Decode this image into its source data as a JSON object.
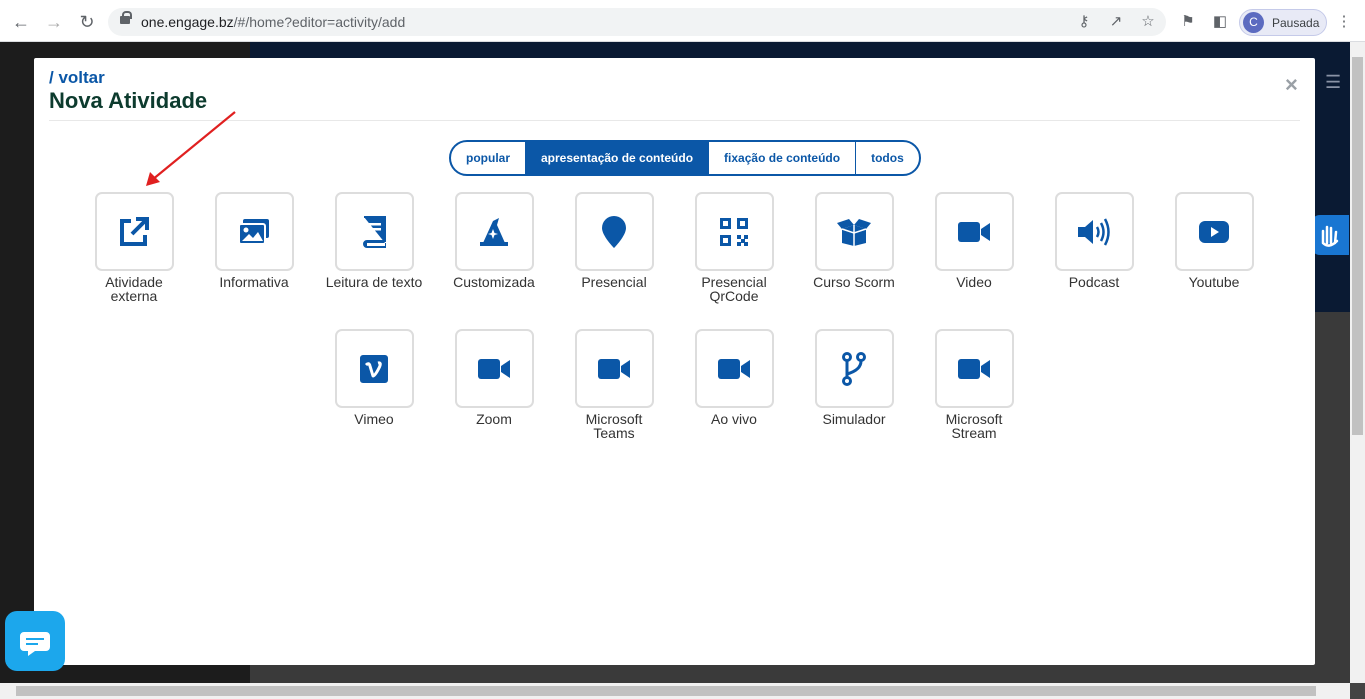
{
  "browser": {
    "url_host": "one.engage.bz",
    "url_path": "/#/home?editor=activity/add",
    "profile_initial": "C",
    "profile_label": "Pausada"
  },
  "modal": {
    "back_label": "/ voltar",
    "title": "Nova Atividade",
    "close_label": "×"
  },
  "tabs": [
    {
      "label": "popular",
      "active": false
    },
    {
      "label": "apresentação de conteúdo",
      "active": true
    },
    {
      "label": "fixação de conteúdo",
      "active": false
    },
    {
      "label": "todos",
      "active": false
    }
  ],
  "tiles": [
    {
      "line1": "Atividade",
      "line2": "externa",
      "icon": "external-link-icon"
    },
    {
      "line1": "Informativa",
      "line2": "",
      "icon": "images-icon"
    },
    {
      "line1": "Leitura de texto",
      "line2": "",
      "icon": "book-icon"
    },
    {
      "line1": "Customizada",
      "line2": "",
      "icon": "wizard-hat-icon"
    },
    {
      "line1": "Presencial",
      "line2": "",
      "icon": "map-pin-icon"
    },
    {
      "line1": "Presencial",
      "line2": "QrCode",
      "icon": "qrcode-icon"
    },
    {
      "line1": "Curso Scorm",
      "line2": "",
      "icon": "box-open-icon"
    },
    {
      "line1": "Video",
      "line2": "",
      "icon": "video-camera-icon"
    },
    {
      "line1": "Podcast",
      "line2": "",
      "icon": "volume-icon"
    },
    {
      "line1": "Youtube",
      "line2": "",
      "icon": "youtube-icon"
    },
    {
      "line1": "Vimeo",
      "line2": "",
      "icon": "vimeo-icon"
    },
    {
      "line1": "Zoom",
      "line2": "",
      "icon": "video-camera-icon"
    },
    {
      "line1": "Microsoft",
      "line2": "Teams",
      "icon": "video-camera-icon"
    },
    {
      "line1": "Ao vivo",
      "line2": "",
      "icon": "video-camera-icon"
    },
    {
      "line1": "Simulador",
      "line2": "",
      "icon": "code-branch-icon"
    },
    {
      "line1": "Microsoft",
      "line2": "Stream",
      "icon": "video-camera-icon"
    }
  ],
  "colors": {
    "accent": "#0b57a7",
    "title": "#0d3b2e",
    "annotation_arrow": "#e02020"
  }
}
